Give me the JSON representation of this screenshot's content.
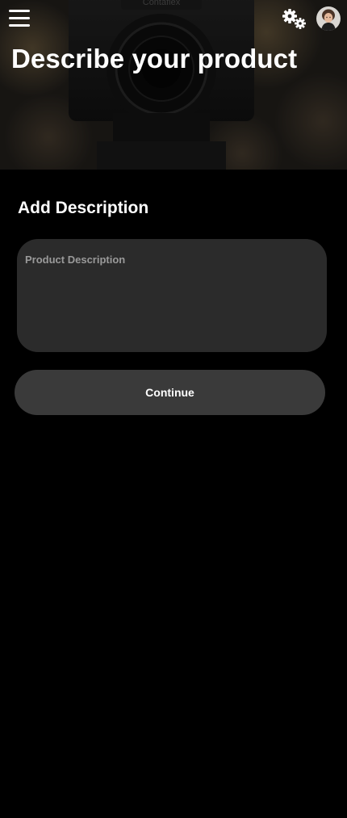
{
  "header": {
    "title": "Describe your product",
    "menu_icon": "hamburger-menu-icon",
    "settings_icon": "gears-icon",
    "avatar_icon": "user-avatar",
    "camera_logo_text": "Contaflex"
  },
  "description_section": {
    "heading": "Add Description",
    "field_placeholder": "Product Description",
    "field_value": ""
  },
  "actions": {
    "continue_label": "Continue"
  },
  "colors": {
    "background": "#000000",
    "field_background": "#2b2b2b",
    "button_background": "#3a3a3a",
    "placeholder_text": "#9a9a9a",
    "text": "#ffffff"
  }
}
